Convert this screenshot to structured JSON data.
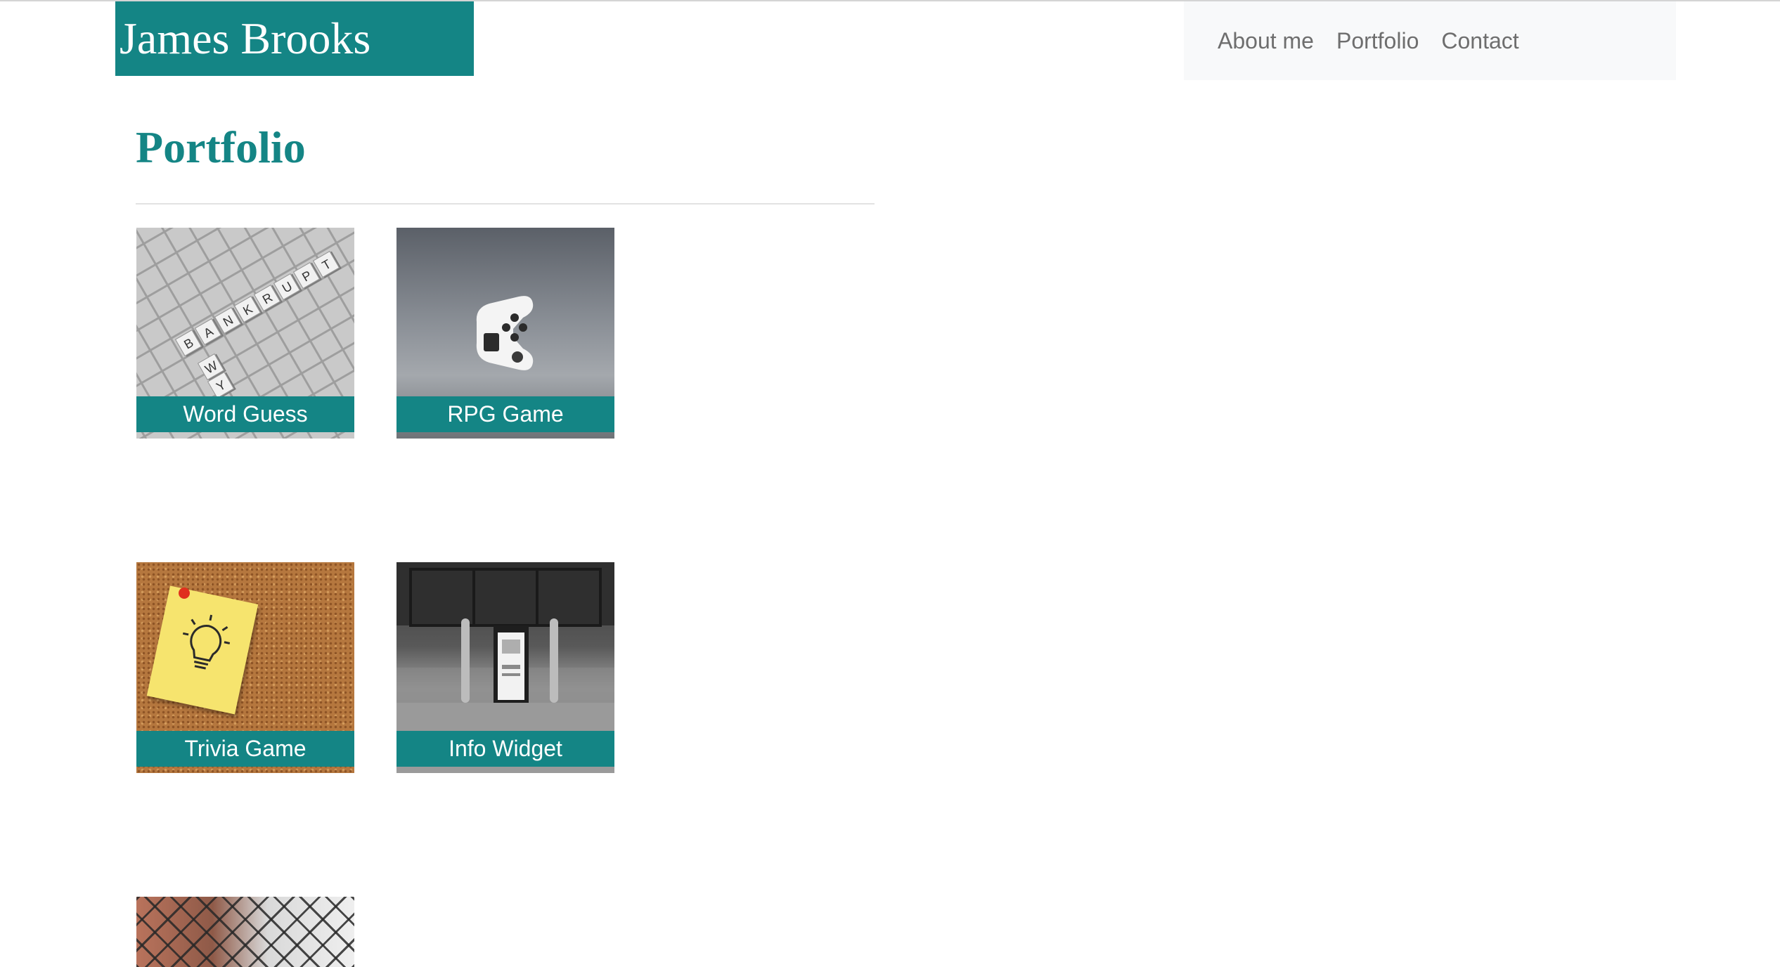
{
  "header": {
    "brand": "James Brooks",
    "nav": [
      {
        "label": "About me"
      },
      {
        "label": "Portfolio"
      },
      {
        "label": "Contact"
      }
    ]
  },
  "main": {
    "title": "Portfolio",
    "projects": [
      {
        "label": "Word Guess"
      },
      {
        "label": "RPG Game"
      },
      {
        "label": "Trivia Game"
      },
      {
        "label": "Info Widget"
      }
    ]
  },
  "colors": {
    "accent": "#148585",
    "nav_background": "#f8f9fa",
    "nav_text": "#6e6e6e"
  }
}
